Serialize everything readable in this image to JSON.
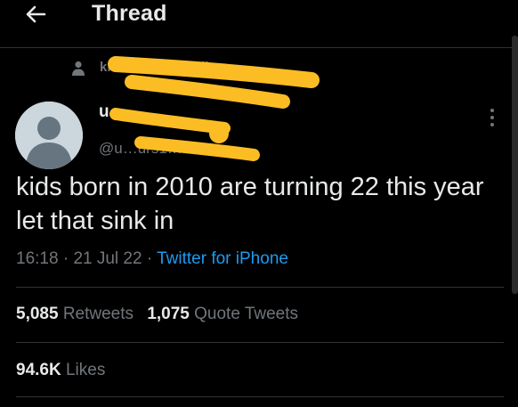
{
  "header": {
    "title": "Thread",
    "back_icon": "arrow-left-icon"
  },
  "social_context": {
    "text": "kira … others follow",
    "icon": "person-icon"
  },
  "author": {
    "display_name": "u…",
    "handle": "@u…urs1…69"
  },
  "tweet": {
    "text": "kids born in 2010 are turning 22 this year let that sink in",
    "time": "16:18",
    "date": "21 Jul 22",
    "separator": "·",
    "source": "Twitter for iPhone"
  },
  "stats": {
    "retweets_count": "5,085",
    "retweets_label": "Retweets",
    "quotes_count": "1,075",
    "quotes_label": "Quote Tweets",
    "likes_count": "94.6K",
    "likes_label": "Likes"
  },
  "colors": {
    "background": "#000000",
    "text": "#e7e9ea",
    "muted": "#71767b",
    "link": "#1d9bf0",
    "divider": "#2f3336",
    "redaction": "#fbbd23"
  }
}
